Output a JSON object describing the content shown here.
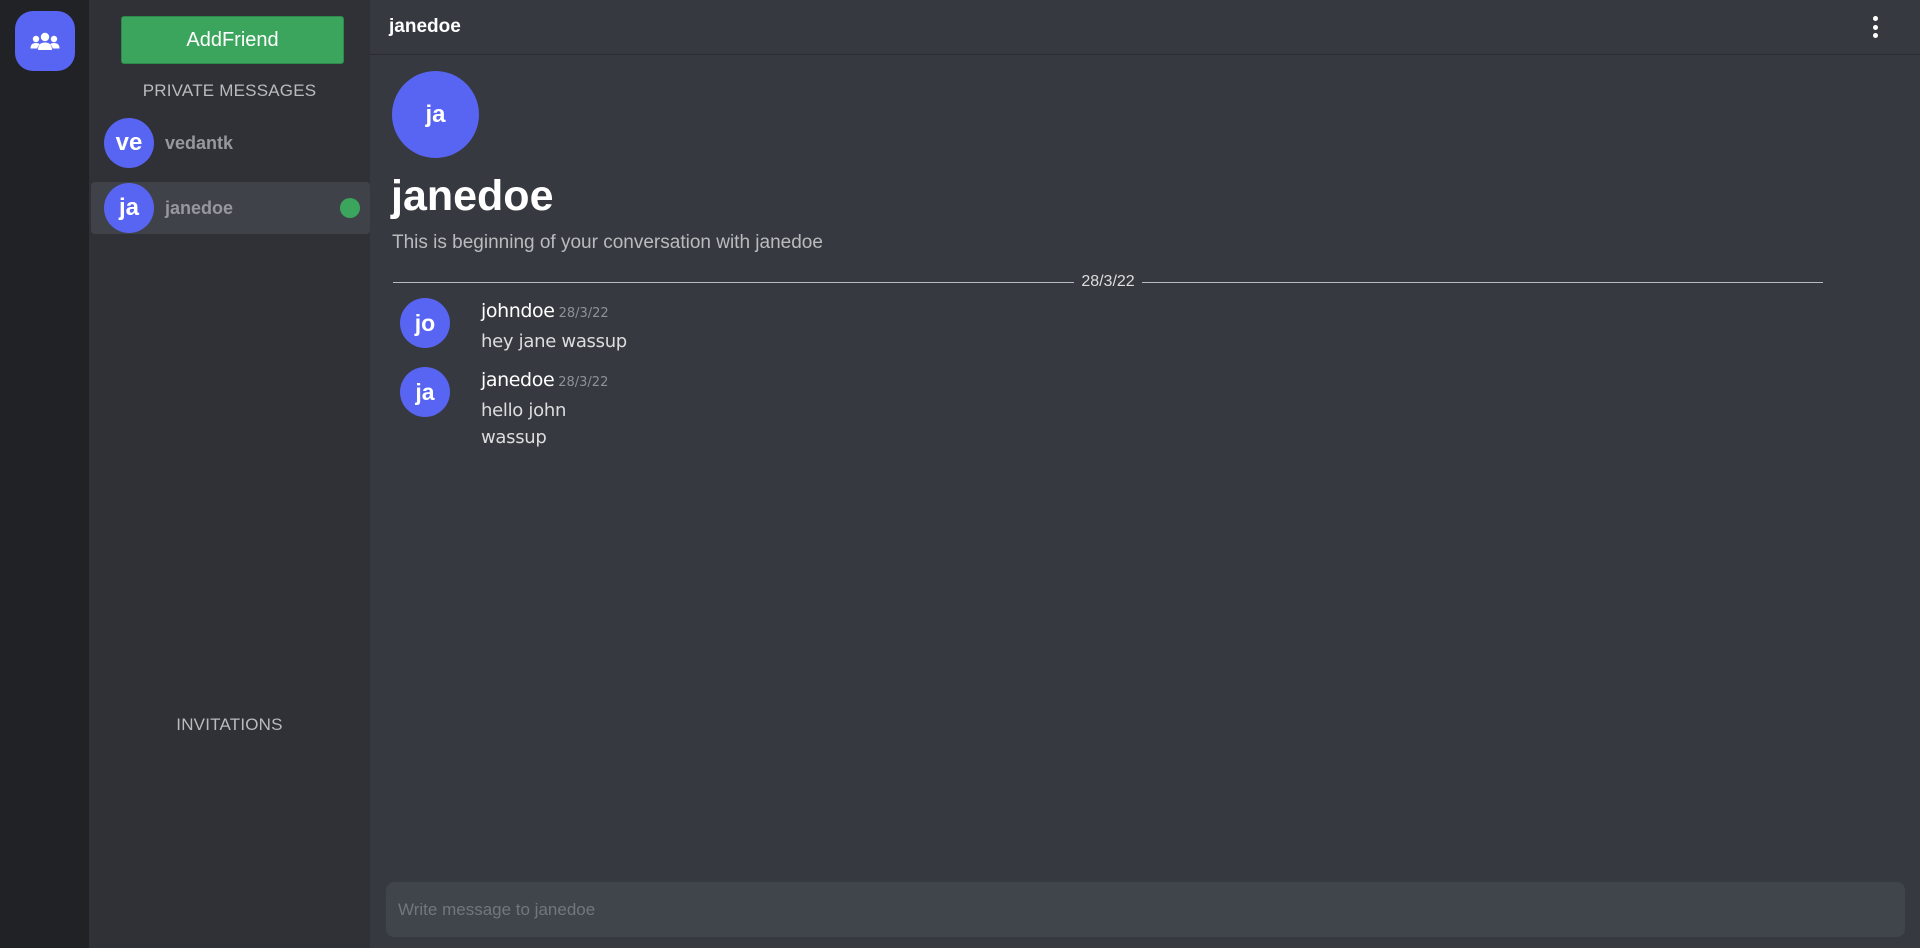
{
  "rail": {
    "friends_icon": "people-group-icon"
  },
  "sidebar": {
    "add_friend_label": "AddFriend",
    "private_messages_title": "PRIVATE MESSAGES",
    "dms": [
      {
        "initials": "ve",
        "name": "vedantk",
        "active": false,
        "online": false
      },
      {
        "initials": "ja",
        "name": "janedoe",
        "active": true,
        "online": true
      }
    ],
    "invitations_title": "INVITATIONS"
  },
  "header": {
    "title": "janedoe",
    "menu_icon": "kebab-menu-icon"
  },
  "conversation": {
    "avatar_initials": "ja",
    "title": "janedoe",
    "subtitle": "This is beginning of your conversation with janedoe",
    "date_divider": "28/3/22",
    "messages": [
      {
        "initials": "jo",
        "author": "johndoe",
        "time": "28/3/22",
        "lines": [
          "hey jane wassup"
        ]
      },
      {
        "initials": "ja",
        "author": "janedoe",
        "time": "28/3/22",
        "lines": [
          "hello john",
          "wassup"
        ]
      }
    ]
  },
  "composer": {
    "placeholder": "Write message to janedoe",
    "value": ""
  },
  "colors": {
    "accent": "#5865f2",
    "success": "#3ba55d",
    "background": "#36393f",
    "sidebar": "#2f3136",
    "rail": "#202225"
  }
}
